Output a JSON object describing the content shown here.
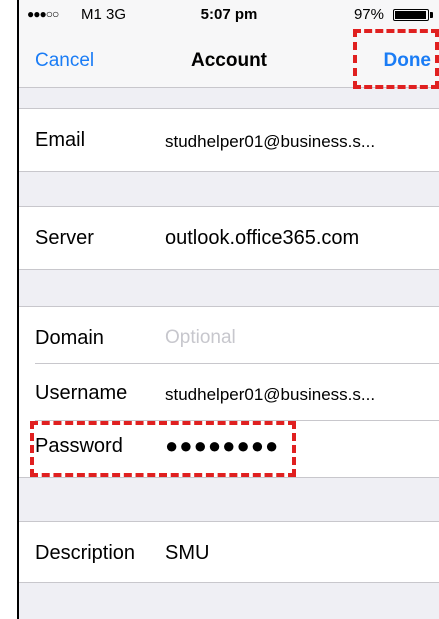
{
  "status_bar": {
    "signal": "●●●○○",
    "carrier": "M1  3G",
    "time": "5:07 pm",
    "battery_pct": "97%",
    "battery_level": 0.97
  },
  "nav": {
    "cancel": "Cancel",
    "title": "Account",
    "done": "Done"
  },
  "fields": {
    "email": {
      "label": "Email",
      "value": "studhelper01@business.s..."
    },
    "server": {
      "label": "Server",
      "value": "outlook.office365.com"
    },
    "domain": {
      "label": "Domain",
      "placeholder": "Optional"
    },
    "username": {
      "label": "Username",
      "value": "studhelper01@business.s..."
    },
    "password": {
      "label": "Password",
      "value": "●●●●●●●●"
    },
    "description": {
      "label": "Description",
      "value": "SMU"
    }
  },
  "colors": {
    "accent": "#1a7cf5",
    "highlight": "#e02020"
  }
}
